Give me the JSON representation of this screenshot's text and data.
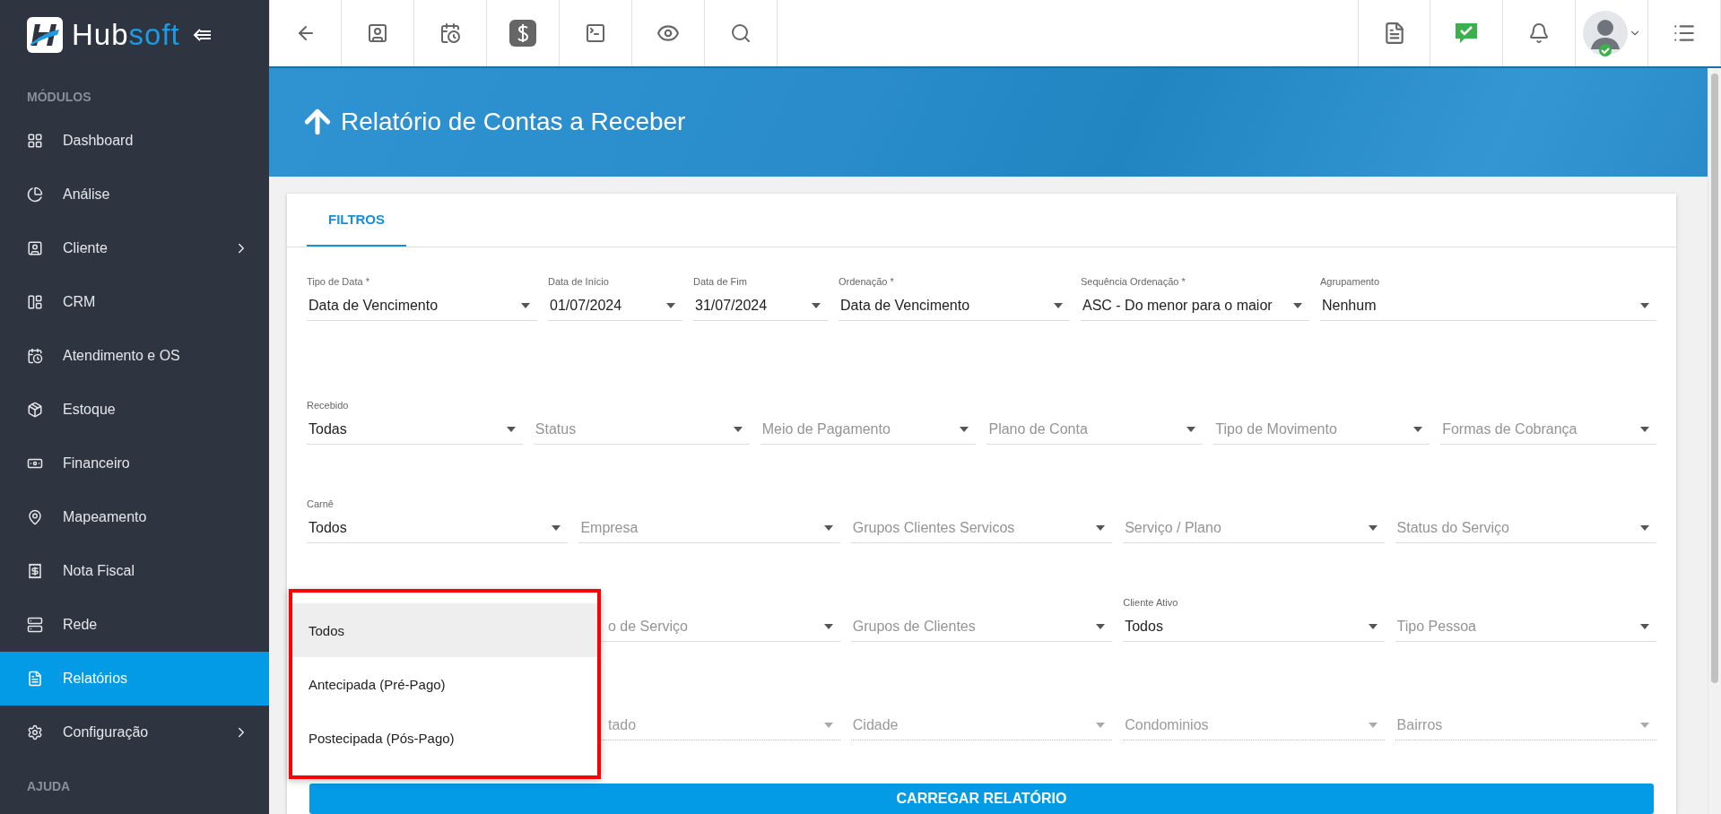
{
  "brand": {
    "text_a": "Hub",
    "text_b": "soft"
  },
  "sidebar": {
    "section_title": "MÓDULOS",
    "items": [
      {
        "label": "Dashboard",
        "selected": false,
        "submenu": false
      },
      {
        "label": "Análise",
        "selected": false,
        "submenu": false
      },
      {
        "label": "Cliente",
        "selected": false,
        "submenu": true
      },
      {
        "label": "CRM",
        "selected": false,
        "submenu": false
      },
      {
        "label": "Atendimento e OS",
        "selected": false,
        "submenu": false
      },
      {
        "label": "Estoque",
        "selected": false,
        "submenu": false
      },
      {
        "label": "Financeiro",
        "selected": false,
        "submenu": false
      },
      {
        "label": "Mapeamento",
        "selected": false,
        "submenu": false
      },
      {
        "label": "Nota Fiscal",
        "selected": false,
        "submenu": false
      },
      {
        "label": "Rede",
        "selected": false,
        "submenu": false
      },
      {
        "label": "Relatórios",
        "selected": true,
        "submenu": false
      },
      {
        "label": "Configuração",
        "selected": false,
        "submenu": true
      }
    ],
    "help_title": "AJUDA"
  },
  "header": {
    "title": "Relatório de Contas a Receber"
  },
  "tabs": [
    {
      "label": "FILTROS",
      "selected": true
    }
  ],
  "filter_rows": [
    {
      "fields": [
        {
          "kind": "select",
          "label": "Tipo de Data *",
          "value": "Data de Vencimento"
        },
        {
          "kind": "select",
          "label": "Data de Início",
          "value": "01/07/2024"
        },
        {
          "kind": "select",
          "label": "Data de Fim",
          "value": "31/07/2024"
        },
        {
          "kind": "select",
          "label": "Ordenação *",
          "value": "Data de Vencimento"
        },
        {
          "kind": "select",
          "label": "Sequência Ordenação *",
          "value": "ASC - Do menor para o maior"
        },
        {
          "kind": "select",
          "label": "Agrupamento",
          "value": "Nenhum"
        }
      ]
    },
    {
      "fields": [
        {
          "kind": "select",
          "label": "Recebido",
          "value": "Todas"
        },
        {
          "kind": "select",
          "placeholder": "Status"
        },
        {
          "kind": "select",
          "placeholder": "Meio de Pagamento"
        },
        {
          "kind": "select",
          "placeholder": "Plano de Conta"
        },
        {
          "kind": "select",
          "placeholder": "Tipo de Movimento"
        },
        {
          "kind": "select",
          "placeholder": "Formas de Cobrança"
        }
      ]
    },
    {
      "fields": [
        {
          "kind": "select",
          "label": "Carnê",
          "value": "Todos"
        },
        {
          "kind": "select",
          "placeholder": "Empresa"
        },
        {
          "kind": "select",
          "placeholder": "Grupos Clientes Servicos"
        },
        {
          "kind": "select",
          "placeholder": "Serviço / Plano"
        },
        {
          "kind": "select",
          "placeholder": "Status do Serviço"
        }
      ]
    },
    {
      "fields": [
        {
          "kind": "clipped",
          "placeholder": "o de Serviço"
        },
        {
          "kind": "select",
          "placeholder": "Grupos de Clientes"
        },
        {
          "kind": "select",
          "label": "Cliente Ativo",
          "value": "Todos"
        },
        {
          "kind": "select",
          "placeholder": "Tipo Pessoa"
        }
      ]
    },
    {
      "fields": [
        {
          "kind": "clipped",
          "placeholder": "tado",
          "disabled": true
        },
        {
          "kind": "select",
          "placeholder": "Cidade",
          "disabled": true
        },
        {
          "kind": "select",
          "placeholder": "Condominios",
          "disabled": true
        },
        {
          "kind": "select",
          "placeholder": "Bairros",
          "disabled": true
        }
      ]
    }
  ],
  "carne_dropdown": {
    "outlined": true,
    "options": [
      {
        "label": "Todos",
        "selected": true
      },
      {
        "label": "Antecipada (Pré-Pago)",
        "selected": false
      },
      {
        "label": "Postecipada (Pós-Pago)",
        "selected": false
      }
    ]
  },
  "load_button": "CARREGAR RELATÓRIO"
}
